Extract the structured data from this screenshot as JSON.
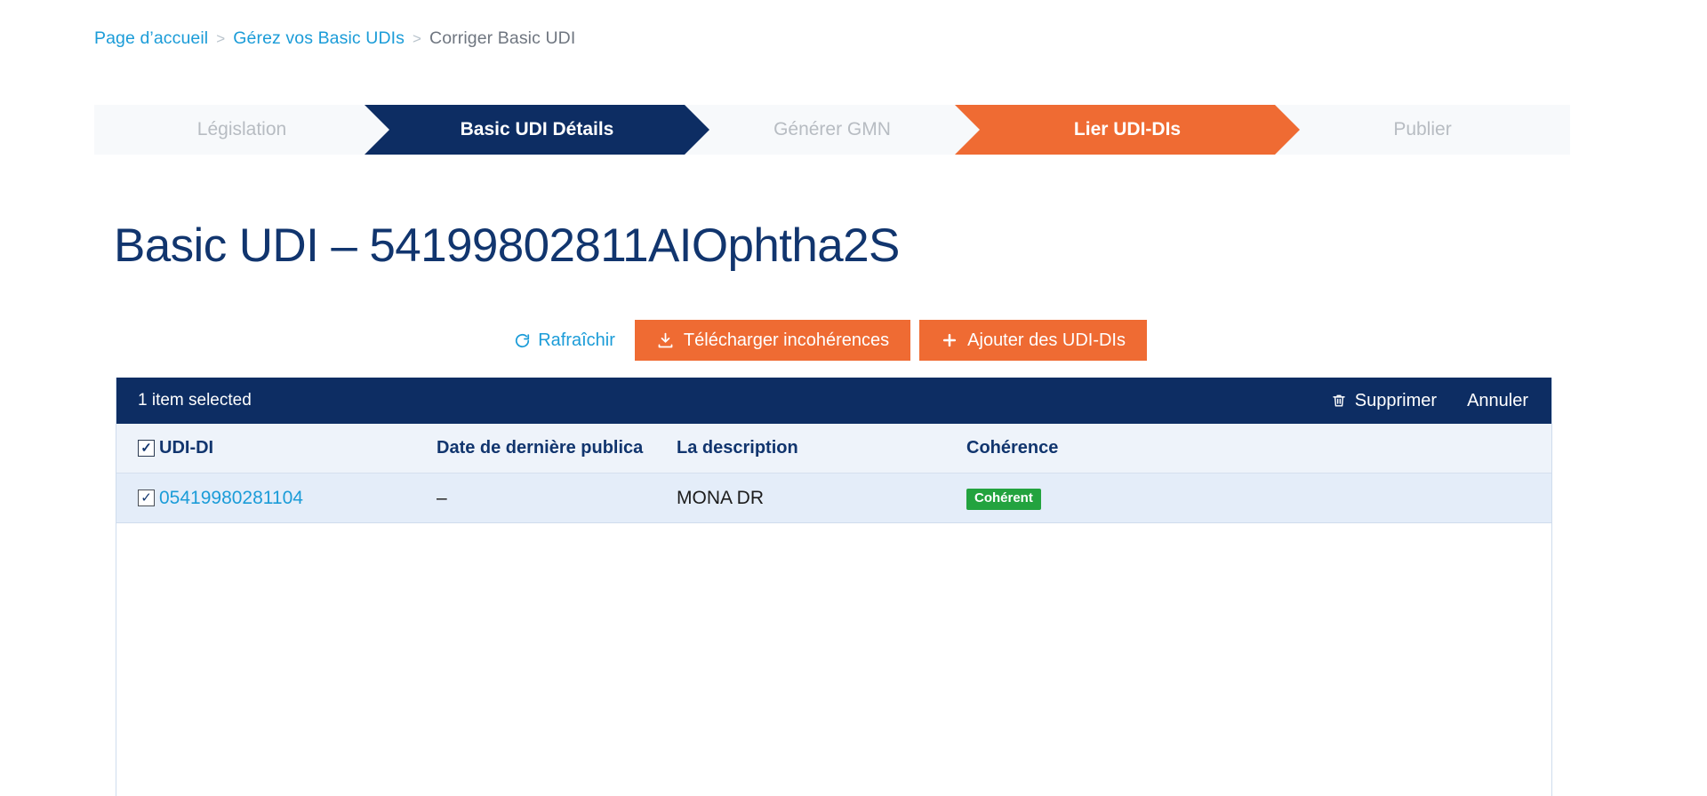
{
  "breadcrumb": {
    "items": [
      {
        "label": "Page d’accueil",
        "type": "link"
      },
      {
        "label": "Gérez vos Basic UDIs",
        "type": "link"
      },
      {
        "label": "Corriger Basic UDI",
        "type": "current"
      }
    ],
    "separator": "›"
  },
  "stepper": {
    "steps": [
      {
        "label": "Législation",
        "state": "inactive"
      },
      {
        "label": "Basic UDI Détails",
        "state": "done",
        "color": "#0d2d63"
      },
      {
        "label": "Générer GMN",
        "state": "inactive"
      },
      {
        "label": "Lier UDI-DIs",
        "state": "active",
        "color": "#ef6b33"
      },
      {
        "label": "Publier",
        "state": "inactive"
      }
    ]
  },
  "page": {
    "title": "Basic UDI – 54199802811AIOphtha2S"
  },
  "toolbar": {
    "refresh_label": "Rafraîchir",
    "refresh_icon": "refresh-icon",
    "download_label": "Télécharger incohérences",
    "download_icon": "download-icon",
    "add_label": "Ajouter des UDI-DIs",
    "add_icon": "plus-icon",
    "accent_color": "#ef6b33",
    "link_color": "#1b9cd8"
  },
  "selection_bar": {
    "status": "1 item selected",
    "delete_label": "Supprimer",
    "delete_icon": "trash-icon",
    "cancel_label": "Annuler",
    "background": "#0d2d63"
  },
  "table": {
    "select_all_checked": true,
    "columns": [
      {
        "key": "udi",
        "label": "UDI-DI"
      },
      {
        "key": "date",
        "label": "Date de dernière publica"
      },
      {
        "key": "description",
        "label": "La description"
      },
      {
        "key": "coherence",
        "label": "Cohérence"
      }
    ],
    "rows": [
      {
        "checked": true,
        "udi": "05419980281104",
        "date": "–",
        "description": "MONA DR",
        "coherence": "Cohérent",
        "coherence_color": "#23a33f"
      }
    ]
  },
  "icons": {
    "check_mark": "✓"
  }
}
